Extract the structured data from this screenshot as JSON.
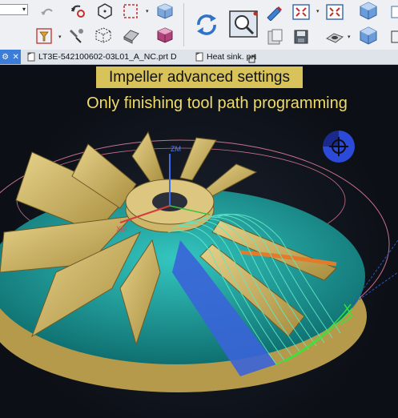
{
  "toolbar": {
    "icons": [
      "combo-selector",
      "undo-icon",
      "transform-icon",
      "hexagon-icon",
      "selection-box-icon",
      "cube-view-icon",
      "rotate-view-icon",
      "zoom-fit-icon",
      "edit-pencil-icon",
      "fit-view-icon",
      "fit-view-alt-icon",
      "shaded-cube-icon",
      "hole-icon",
      "save-icon",
      "folder-icon",
      "shape-icon"
    ]
  },
  "tabs": [
    {
      "label": "LT3E-542100602-03L01_A_NC.prt D"
    },
    {
      "label": "Heat sink. prt"
    }
  ],
  "overlay": {
    "title": "Impeller advanced settings",
    "subtitle": "Only finishing tool path programming"
  },
  "axes": {
    "z": "ZM",
    "x": "XM"
  },
  "colors": {
    "blade": "#c8b064",
    "hub": "#1e9c9a",
    "toolpath": "#5fe8c4",
    "highlight": "#d8c35a",
    "orient": "#2c49d8"
  }
}
